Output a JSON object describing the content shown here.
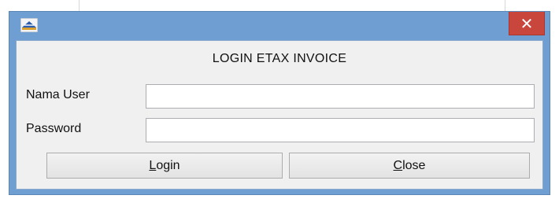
{
  "window": {
    "close_glyph": "✕",
    "app_icon": "etax-logo-icon"
  },
  "form": {
    "heading": "LOGIN ETAX INVOICE",
    "username_label": "Nama User",
    "username_value": "",
    "password_label": "Password",
    "password_value": ""
  },
  "buttons": {
    "login": {
      "mnemonic": "L",
      "rest": "ogin"
    },
    "close": {
      "mnemonic": "C",
      "rest": "lose"
    }
  },
  "colors": {
    "titlebar": "#6f9fd2",
    "close_button": "#c9463d",
    "client_bg": "#f0f0f0"
  }
}
